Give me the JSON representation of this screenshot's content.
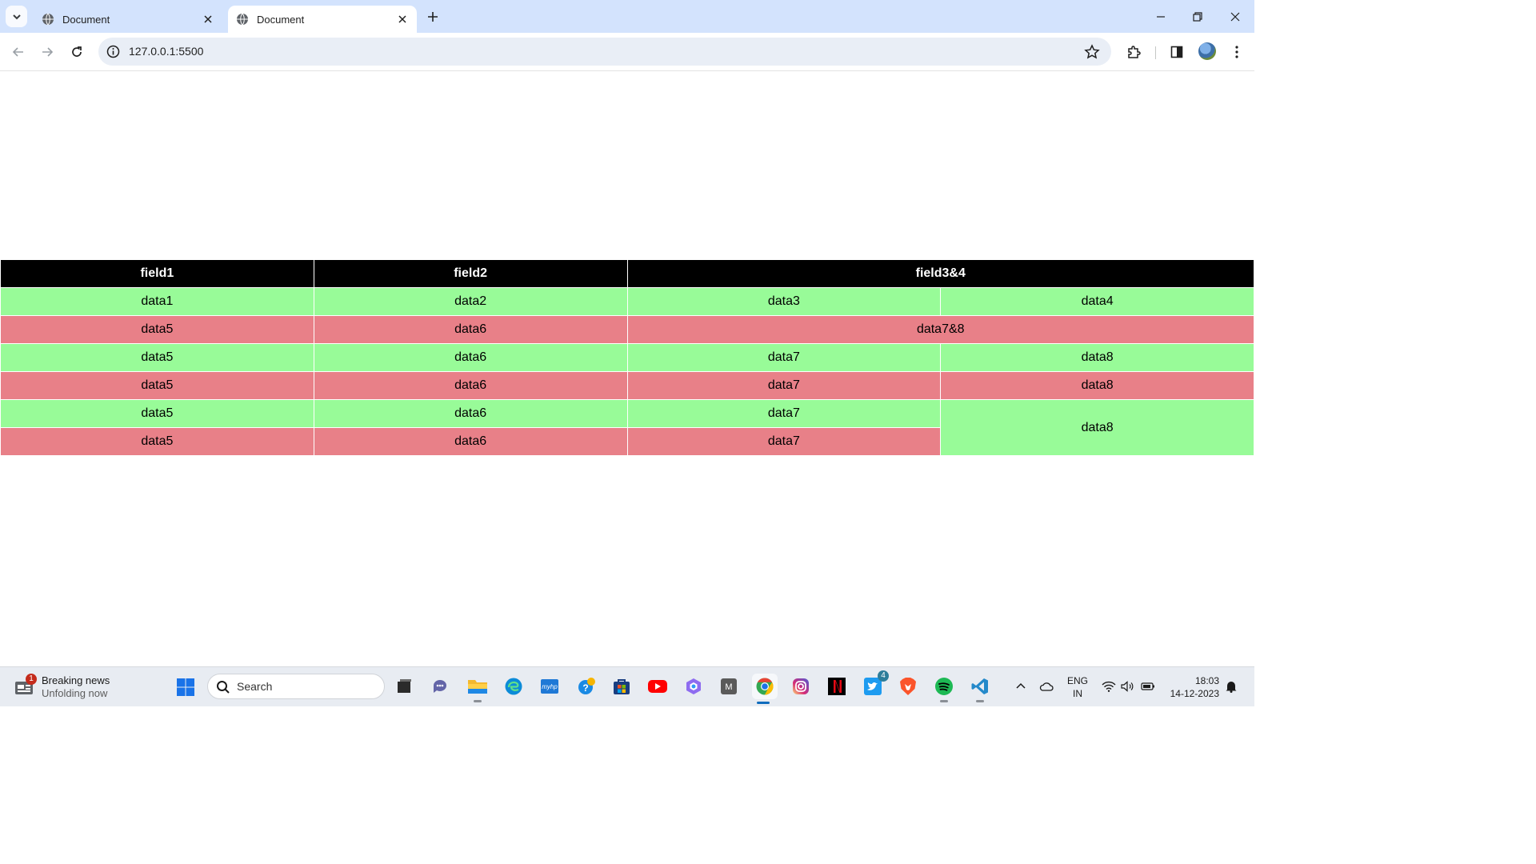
{
  "browser": {
    "tabs": [
      {
        "title": "Document",
        "active": false
      },
      {
        "title": "Document",
        "active": true
      }
    ],
    "url": "127.0.0.1:5500"
  },
  "table": {
    "headers": [
      "field1",
      "field2",
      "field3&4"
    ],
    "rows": [
      [
        "data1",
        "data2",
        "data3",
        "data4"
      ],
      [
        "data5",
        "data6",
        "data7&8"
      ],
      [
        "data5",
        "data6",
        "data7",
        "data8"
      ],
      [
        "data5",
        "data6",
        "data7",
        "data8"
      ],
      [
        "data5",
        "data6",
        "data7",
        "data8"
      ],
      [
        "data5",
        "data6",
        "data7"
      ]
    ],
    "colors": {
      "header": "#000000",
      "green": "#98fb98",
      "red": "#e88088"
    }
  },
  "taskbar": {
    "news": {
      "title": "Breaking news",
      "subtitle": "Unfolding now",
      "badge": "1"
    },
    "search_placeholder": "Search",
    "twitter_badge": "4",
    "lang_line1": "ENG",
    "lang_line2": "IN",
    "time": "18:03",
    "date": "14-12-2023"
  }
}
